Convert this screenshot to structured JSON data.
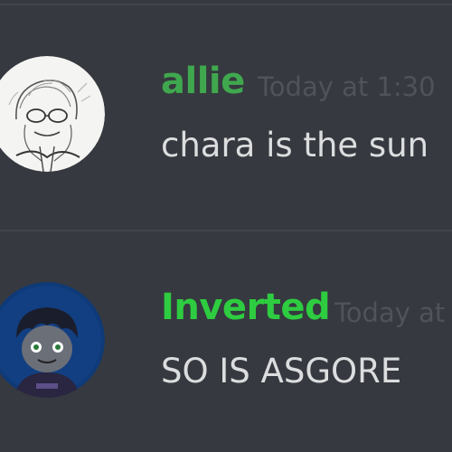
{
  "theme": {
    "background": "#36393f",
    "divider": "#41444a",
    "timestamp_color": "#4f535a",
    "text_color": "#dcddde"
  },
  "messages": [
    {
      "username": "allie",
      "username_color": "#3fa84e",
      "timestamp": "Today at 1:30",
      "content": "chara is the sun",
      "avatar": "sketch-portrait-avatar"
    },
    {
      "username": "Inverted",
      "username_color": "#2ecc40",
      "timestamp": "Today at",
      "content": "SO IS ASGORE",
      "avatar": "dark-character-avatar"
    }
  ]
}
